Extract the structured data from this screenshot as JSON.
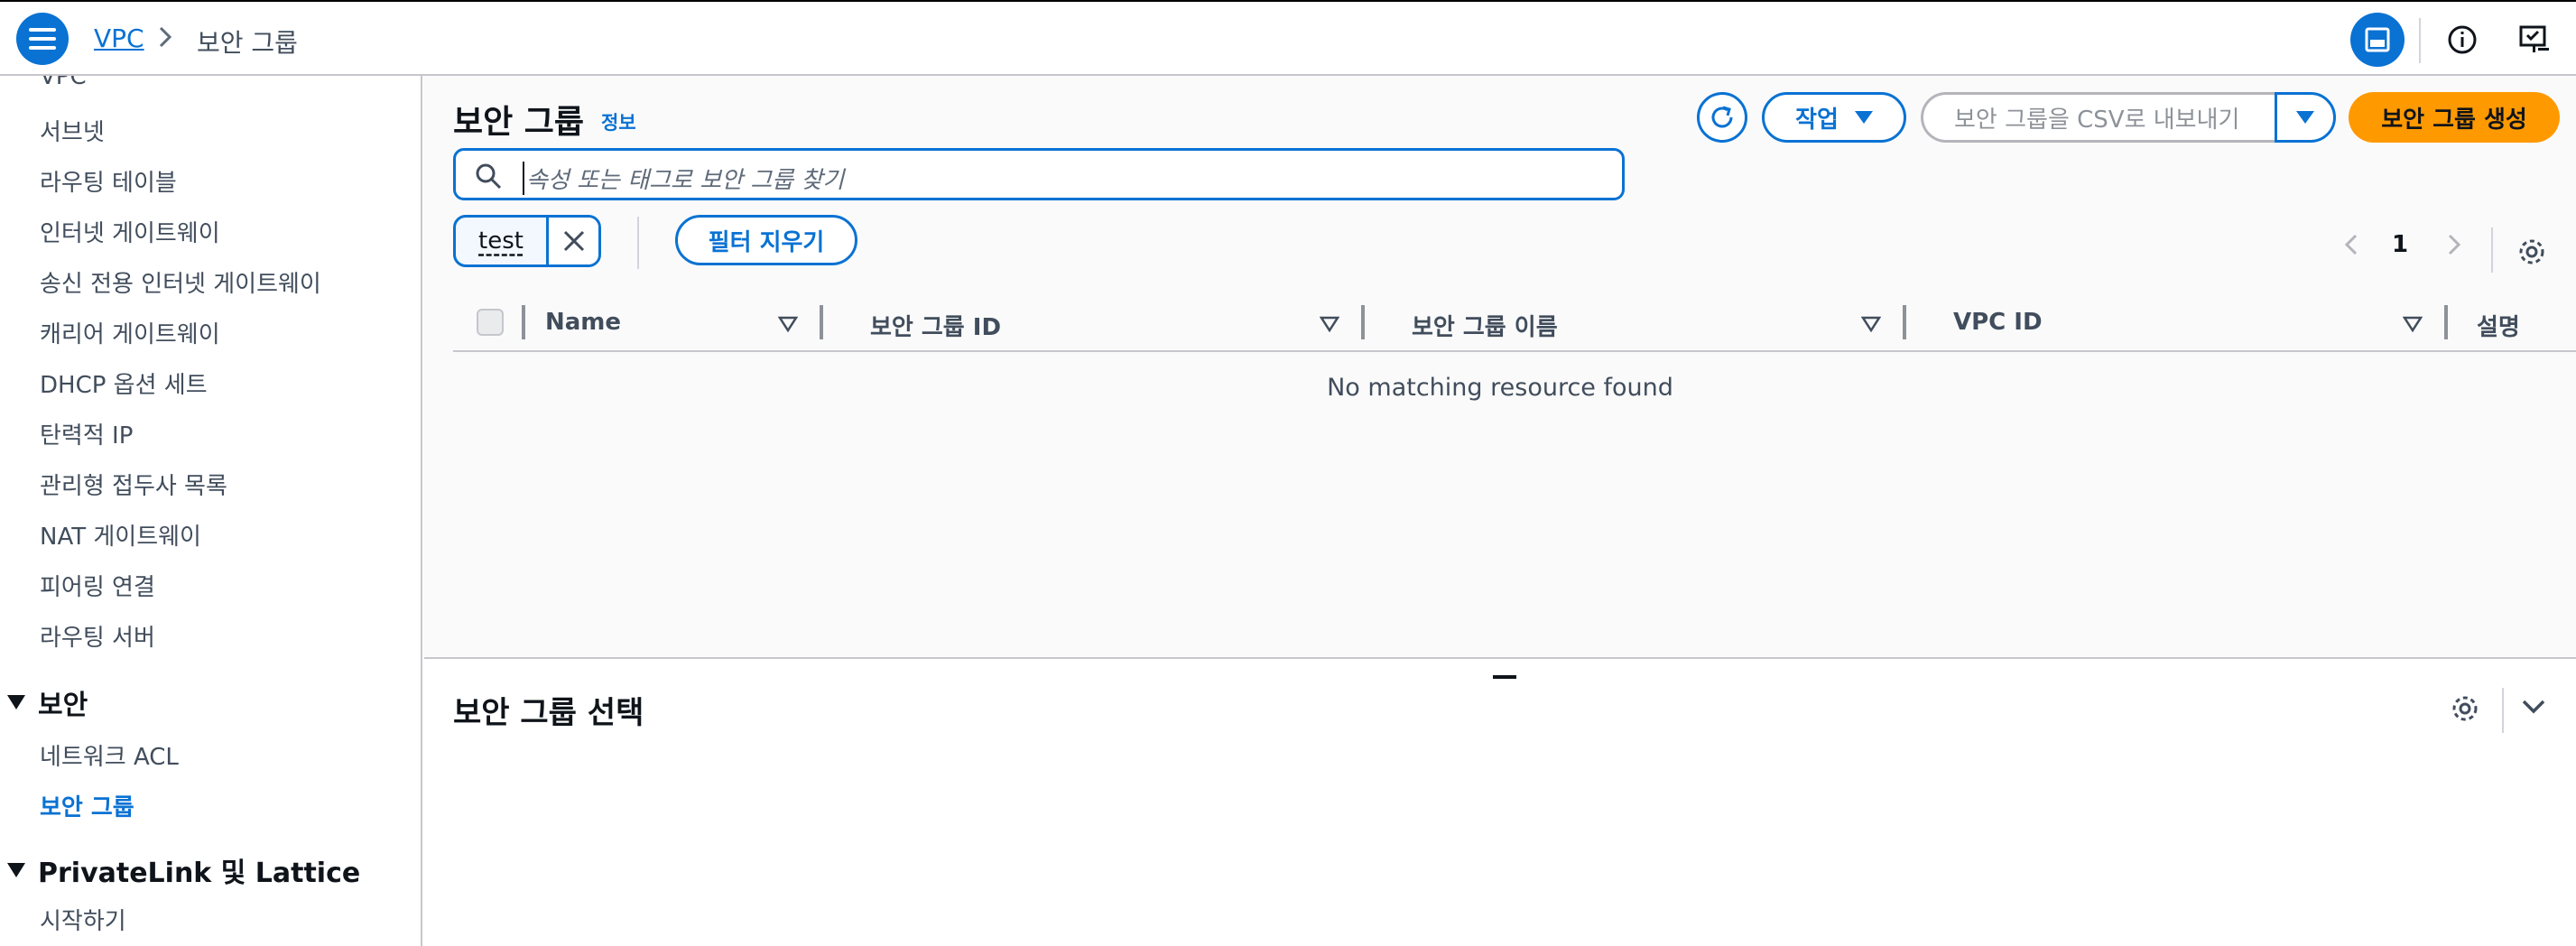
{
  "breadcrumb": {
    "root": "VPC",
    "current": "보안 그룹"
  },
  "sidebar": {
    "items": [
      {
        "label": "VPC"
      },
      {
        "label": "서브넷"
      },
      {
        "label": "라우팅 테이블"
      },
      {
        "label": "인터넷 게이트웨이"
      },
      {
        "label": "송신 전용 인터넷 게이트웨이"
      },
      {
        "label": "캐리어 게이트웨이"
      },
      {
        "label": "DHCP 옵션 세트"
      },
      {
        "label": "탄력적 IP"
      },
      {
        "label": "관리형 접두사 목록"
      },
      {
        "label": "NAT 게이트웨이"
      },
      {
        "label": "피어링 연결"
      },
      {
        "label": "라우팅 서버"
      }
    ],
    "security_section": "보안",
    "security_items": [
      {
        "label": "네트워크 ACL"
      },
      {
        "label": "보안 그룹"
      }
    ],
    "privatelink_section": "PrivateLink 및 Lattice",
    "privatelink_items": [
      {
        "label": "시작하기"
      }
    ]
  },
  "main": {
    "title": "보안 그룹",
    "info": "정보",
    "actions_label": "작업",
    "export_label": "보안 그룹을 CSV로 내보내기",
    "create_label": "보안 그룹 생성",
    "search_placeholder": "속성 또는 태그로 보안 그룹 찾기",
    "filter_token": "test",
    "clear_filters": "필터 지우기",
    "page": "1",
    "columns": [
      "Name",
      "보안 그룹 ID",
      "보안 그룹 이름",
      "VPC ID",
      "설명"
    ],
    "empty_message": "No matching resource found"
  },
  "split_panel": {
    "title": "보안 그룹 선택"
  },
  "colors": {
    "accent": "#0972d3",
    "primary_button": "#ff9900"
  }
}
